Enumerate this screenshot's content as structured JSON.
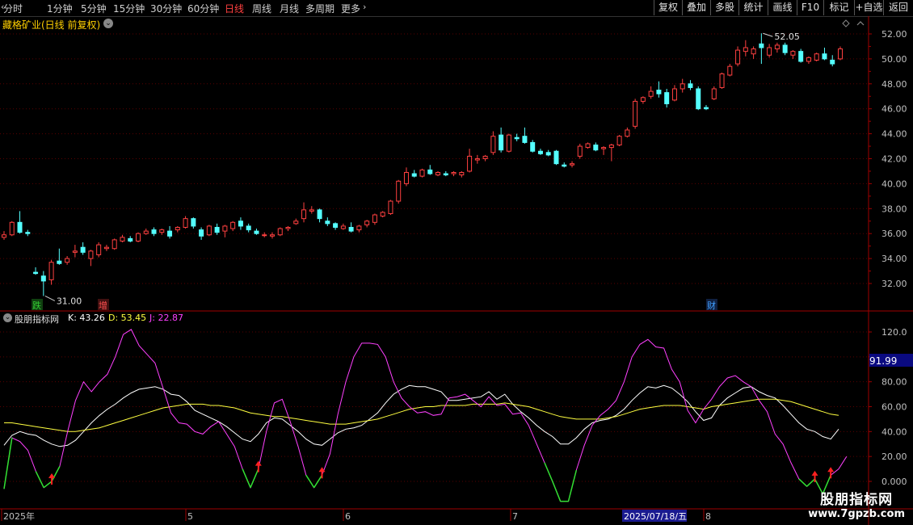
{
  "toolbar": {
    "periods": [
      {
        "label": "分时",
        "active": false
      },
      {
        "label": "1分钟",
        "active": false
      },
      {
        "label": "5分钟",
        "active": false
      },
      {
        "label": "15分钟",
        "active": false
      },
      {
        "label": "30分钟",
        "active": false
      },
      {
        "label": "60分钟",
        "active": false
      },
      {
        "label": "日线",
        "active": true
      },
      {
        "label": "周线",
        "active": false
      },
      {
        "label": "月线",
        "active": false
      },
      {
        "label": "多周期",
        "active": false
      },
      {
        "label": "更多",
        "active": false
      }
    ],
    "buttons": [
      "复权",
      "叠加",
      "多股",
      "统计",
      "画线",
      "F10",
      "标记",
      "+自选",
      "返回"
    ]
  },
  "main_chart": {
    "title": "藏格矿业(日线 前复权)",
    "high_label": "52.05",
    "low_label": "31.00",
    "price_axis": [
      "52.00",
      "50.00",
      "48.00",
      "46.00",
      "44.00",
      "42.00",
      "40.00",
      "38.00",
      "36.00",
      "34.00",
      "32.00"
    ],
    "event_markers": [
      {
        "label": "跌",
        "color": "#33cc33",
        "bg": "#104010"
      },
      {
        "label": "增",
        "color": "#ff5050",
        "bg": "#401010"
      },
      {
        "label": "财",
        "color": "#40a0ff",
        "bg": "#102040"
      }
    ]
  },
  "indicator": {
    "name": "股朋指标网",
    "k_label": "K: 43.26",
    "d_label": "D: 53.45",
    "j_label": "J: 22.87",
    "axis": [
      "120.0",
      "100.0",
      "80.00",
      "60.00",
      "40.00",
      "20.00",
      "0.000"
    ],
    "current_value": "91.99"
  },
  "date_axis": {
    "labels": [
      "2025年",
      "5",
      "6",
      "7",
      "8"
    ],
    "cursor_date": "2025/07/18/五"
  },
  "watermark": {
    "title": "股朋指标网",
    "url": "www.7gpzb.com"
  },
  "colors": {
    "up": "#ff4040",
    "down": "#54ffff",
    "k": "#ffffff",
    "d": "#ffff40",
    "j": "#ff40ff",
    "grid": "#5a0000",
    "border": "#a00000",
    "axis_text": "#c0c0c0"
  },
  "chart_data": [
    {
      "type": "candlestick",
      "title": "藏格矿业(日线 前复权)",
      "ylim": [
        30.5,
        53
      ],
      "candles": [
        [
          35.7,
          36.2,
          35.5,
          35.9
        ],
        [
          35.9,
          37.0,
          35.8,
          36.9
        ],
        [
          36.9,
          37.8,
          36.0,
          36.1
        ],
        [
          36.1,
          36.3,
          35.8,
          36.0
        ],
        [
          32.9,
          33.3,
          32.7,
          32.8
        ],
        [
          32.6,
          33.0,
          31.0,
          32.2
        ],
        [
          32.3,
          33.9,
          31.9,
          33.7
        ],
        [
          33.8,
          34.8,
          33.5,
          33.6
        ],
        [
          33.7,
          34.2,
          33.5,
          34.0
        ],
        [
          34.5,
          35.1,
          34.1,
          34.6
        ],
        [
          34.9,
          35.3,
          34.3,
          34.5
        ],
        [
          34.0,
          34.7,
          33.4,
          34.6
        ],
        [
          34.3,
          35.3,
          34.1,
          35.1
        ],
        [
          34.8,
          35.1,
          34.6,
          34.9
        ],
        [
          34.8,
          35.6,
          34.7,
          35.5
        ],
        [
          35.4,
          35.9,
          35.3,
          35.7
        ],
        [
          35.6,
          35.8,
          35.3,
          35.4
        ],
        [
          35.4,
          36.1,
          35.3,
          36.0
        ],
        [
          36.0,
          36.4,
          35.9,
          36.2
        ],
        [
          36.3,
          36.5,
          35.8,
          36.0
        ],
        [
          36.1,
          36.4,
          35.9,
          36.3
        ],
        [
          36.2,
          36.6,
          35.6,
          35.8
        ],
        [
          36.3,
          36.6,
          36.1,
          36.5
        ],
        [
          36.5,
          37.4,
          36.4,
          37.2
        ],
        [
          37.2,
          37.3,
          36.4,
          36.6
        ],
        [
          36.3,
          36.5,
          35.5,
          35.8
        ],
        [
          35.9,
          36.7,
          35.8,
          36.6
        ],
        [
          36.5,
          36.8,
          35.9,
          36.1
        ],
        [
          36.2,
          36.7,
          35.7,
          36.6
        ],
        [
          36.4,
          37.0,
          36.2,
          36.9
        ],
        [
          37.0,
          37.3,
          36.3,
          36.6
        ],
        [
          36.6,
          36.8,
          36.1,
          36.3
        ],
        [
          36.2,
          36.4,
          35.9,
          36.0
        ],
        [
          35.9,
          36.1,
          35.7,
          35.9
        ],
        [
          35.8,
          36.1,
          35.6,
          35.9
        ],
        [
          35.9,
          36.5,
          35.8,
          36.4
        ],
        [
          36.4,
          36.6,
          36.2,
          36.5
        ],
        [
          36.8,
          37.2,
          36.7,
          37.0
        ],
        [
          37.2,
          38.5,
          36.9,
          37.9
        ],
        [
          37.8,
          38.2,
          37.6,
          37.9
        ],
        [
          37.9,
          38.0,
          36.9,
          37.2
        ],
        [
          37.0,
          37.3,
          36.6,
          36.8
        ],
        [
          36.8,
          36.9,
          36.3,
          36.5
        ],
        [
          36.4,
          36.8,
          36.3,
          36.6
        ],
        [
          36.5,
          36.9,
          36.1,
          36.2
        ],
        [
          36.3,
          36.7,
          36.1,
          36.6
        ],
        [
          36.7,
          37.1,
          36.5,
          37.0
        ],
        [
          36.9,
          37.6,
          36.7,
          37.5
        ],
        [
          37.4,
          37.8,
          37.3,
          37.7
        ],
        [
          37.6,
          38.7,
          37.5,
          38.6
        ],
        [
          38.6,
          40.3,
          38.4,
          40.2
        ],
        [
          40.0,
          41.3,
          39.8,
          40.9
        ],
        [
          40.8,
          41.1,
          40.5,
          40.6
        ],
        [
          40.6,
          41.2,
          40.5,
          41.1
        ],
        [
          41.1,
          41.5,
          40.7,
          40.8
        ],
        [
          40.7,
          41.0,
          40.6,
          40.9
        ],
        [
          40.8,
          41.0,
          40.6,
          40.7
        ],
        [
          40.8,
          41.0,
          40.6,
          40.9
        ],
        [
          40.7,
          41.0,
          40.5,
          40.9
        ],
        [
          41.0,
          42.8,
          40.9,
          42.2
        ],
        [
          41.9,
          42.3,
          41.6,
          42.0
        ],
        [
          42.0,
          42.3,
          41.8,
          42.2
        ],
        [
          42.5,
          44.2,
          42.3,
          43.8
        ],
        [
          43.9,
          44.5,
          42.5,
          42.7
        ],
        [
          42.6,
          44.0,
          42.5,
          43.9
        ],
        [
          43.7,
          44.0,
          43.4,
          43.6
        ],
        [
          43.8,
          44.5,
          43.2,
          43.3
        ],
        [
          43.3,
          43.5,
          42.5,
          42.6
        ],
        [
          42.6,
          42.8,
          42.3,
          42.4
        ],
        [
          42.5,
          42.7,
          42.2,
          42.3
        ],
        [
          42.6,
          42.7,
          41.5,
          41.6
        ],
        [
          41.5,
          41.7,
          41.3,
          41.4
        ],
        [
          41.5,
          41.8,
          41.3,
          41.6
        ],
        [
          42.2,
          43.2,
          42.0,
          43.0
        ],
        [
          42.9,
          43.3,
          42.8,
          43.2
        ],
        [
          43.1,
          43.3,
          42.6,
          42.7
        ],
        [
          42.8,
          43.0,
          42.3,
          42.9
        ],
        [
          42.9,
          43.2,
          41.8,
          43.1
        ],
        [
          43.1,
          43.9,
          43.0,
          43.8
        ],
        [
          43.8,
          44.5,
          43.7,
          44.3
        ],
        [
          44.6,
          46.8,
          44.4,
          46.6
        ],
        [
          46.6,
          47.0,
          46.4,
          46.9
        ],
        [
          47.0,
          47.8,
          46.8,
          47.4
        ],
        [
          47.5,
          48.2,
          46.9,
          47.2
        ],
        [
          47.3,
          47.6,
          46.1,
          46.4
        ],
        [
          46.7,
          47.9,
          46.6,
          47.6
        ],
        [
          47.6,
          48.4,
          47.3,
          48.0
        ],
        [
          48.0,
          48.3,
          47.5,
          47.7
        ],
        [
          47.6,
          47.8,
          45.9,
          46.0
        ],
        [
          46.1,
          46.3,
          45.9,
          46.0
        ],
        [
          46.8,
          47.8,
          46.7,
          47.6
        ],
        [
          47.7,
          48.9,
          47.6,
          48.8
        ],
        [
          48.7,
          49.6,
          48.6,
          49.4
        ],
        [
          49.6,
          51.0,
          49.4,
          50.7
        ],
        [
          50.6,
          51.5,
          50.2,
          50.9
        ],
        [
          50.4,
          51.0,
          50.0,
          50.8
        ],
        [
          51.2,
          52.05,
          49.6,
          50.9
        ],
        [
          50.3,
          51.2,
          50.1,
          50.9
        ],
        [
          50.8,
          51.3,
          50.5,
          51.1
        ],
        [
          51.1,
          51.3,
          50.3,
          50.5
        ],
        [
          50.3,
          50.7,
          50.0,
          50.6
        ],
        [
          50.6,
          50.8,
          49.7,
          49.8
        ],
        [
          49.8,
          50.2,
          49.6,
          50.1
        ],
        [
          49.9,
          50.5,
          49.8,
          50.4
        ],
        [
          50.4,
          50.9,
          49.9,
          50.0
        ],
        [
          49.9,
          50.3,
          49.4,
          49.6
        ],
        [
          50.0,
          51.0,
          49.9,
          50.8
        ]
      ]
    },
    {
      "type": "line",
      "title": "股朋指标网",
      "ylim": [
        -10,
        125
      ],
      "series": [
        {
          "name": "K",
          "values": [
            29,
            37,
            40,
            38,
            37,
            33,
            30,
            28,
            29,
            33,
            40,
            47,
            53,
            58,
            62,
            67,
            71,
            74,
            75,
            76,
            74,
            70,
            69,
            64,
            57,
            54,
            51,
            48,
            44,
            39,
            34,
            32,
            38,
            47,
            51,
            50,
            45,
            40,
            34,
            30,
            29,
            34,
            39,
            42,
            43,
            45,
            50,
            55,
            63,
            70,
            74,
            77,
            76,
            76,
            74,
            72,
            65,
            65,
            66,
            67,
            68,
            72,
            66,
            70,
            62,
            56,
            51,
            45,
            40,
            36,
            30,
            30,
            35,
            42,
            47,
            49,
            50,
            53,
            58,
            65,
            71,
            76,
            75,
            77,
            75,
            70,
            64,
            56,
            49,
            51,
            61,
            67,
            71,
            75,
            76,
            72,
            69,
            67,
            61,
            54,
            47,
            42,
            40,
            36,
            34,
            42
          ]
        },
        {
          "name": "D",
          "values": [
            47,
            47,
            46,
            45,
            44,
            43,
            42,
            41,
            40,
            40,
            41,
            42,
            43,
            45,
            47,
            49,
            51,
            53,
            55,
            57,
            59,
            60,
            61,
            62,
            62,
            62,
            61,
            61,
            60,
            59,
            57,
            55,
            54,
            53,
            52,
            52,
            51,
            50,
            49,
            48,
            47,
            46,
            46,
            46,
            47,
            48,
            49,
            50,
            52,
            54,
            56,
            58,
            59,
            60,
            60,
            61,
            61,
            61,
            61,
            62,
            62,
            62,
            62,
            63,
            62,
            61,
            60,
            58,
            56,
            54,
            52,
            51,
            50,
            50,
            50,
            50,
            51,
            52,
            54,
            56,
            58,
            59,
            60,
            61,
            61,
            61,
            60,
            59,
            58,
            60,
            61,
            62,
            63,
            64,
            65,
            66,
            66,
            66,
            65,
            64,
            62,
            60,
            58,
            56,
            54,
            53
          ]
        },
        {
          "name": "J",
          "values": [
            -6,
            35,
            32,
            25,
            8,
            -5,
            0,
            12,
            40,
            65,
            80,
            72,
            80,
            86,
            100,
            118,
            122,
            109,
            102,
            95,
            75,
            55,
            47,
            46,
            40,
            38,
            44,
            48,
            38,
            28,
            10,
            -5,
            10,
            40,
            63,
            66,
            48,
            28,
            5,
            -5,
            5,
            22,
            54,
            80,
            100,
            111,
            111,
            110,
            100,
            80,
            67,
            60,
            55,
            56,
            53,
            54,
            67,
            68,
            70,
            65,
            60,
            68,
            61,
            62,
            54,
            55,
            45,
            30,
            15,
            0,
            -16,
            -16,
            9,
            29,
            45,
            53,
            58,
            65,
            80,
            100,
            110,
            114,
            108,
            107,
            90,
            80,
            57,
            47,
            58,
            66,
            76,
            83,
            85,
            80,
            76,
            65,
            56,
            38,
            30,
            15,
            2,
            -4,
            2,
            -10,
            5,
            10,
            20
          ]
        }
      ]
    }
  ]
}
